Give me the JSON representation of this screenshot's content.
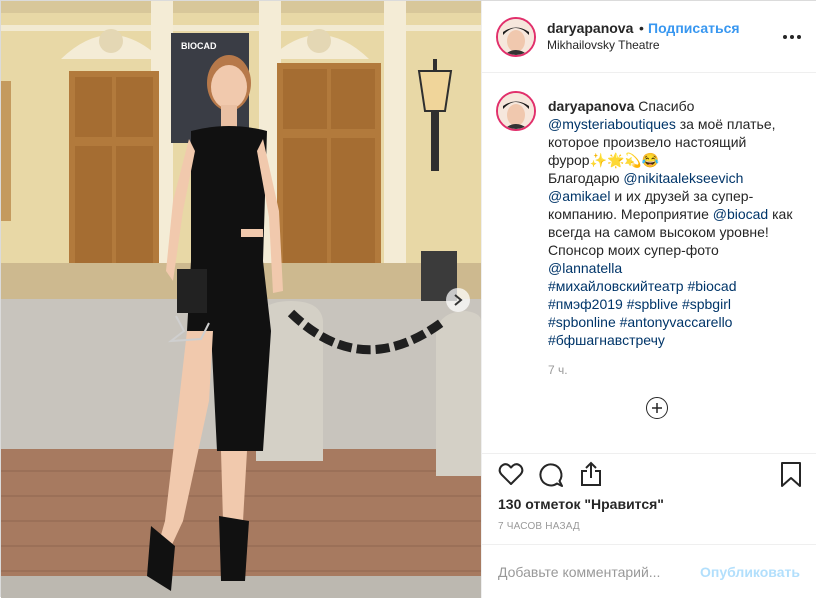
{
  "post": {
    "username": "daryapanova",
    "separator": "•",
    "follow_label": "Подписаться",
    "location": "Mikhailovsky Theatre",
    "photo_sign_text": "BIOCAD"
  },
  "caption": {
    "username": "daryapanova",
    "text_1": " Спасибо",
    "mention_1": "@mysteriaboutiques",
    "text_2": " за моё платье,",
    "text_3": "которое произвело настоящий",
    "text_4": "фурор✨🌟💫😂",
    "text_5": "Благодарю ",
    "mention_2": "@nikitaalekseevich",
    "mention_3": "@amikael",
    "text_6": " и их друзей за супер-",
    "text_7": "компанию. Мероприятие ",
    "mention_4": "@biocad",
    "text_8": " как",
    "text_9": "всегда на самом высоком уровне!",
    "text_10": "Спонсор моих супер-фото",
    "mention_5": "@lannatella",
    "hashtags_line_1": "#михайловскийтеатр #biocad",
    "hashtags_line_2": "#пмэф2019 #spblive #spbgirl",
    "hashtags_line_3": "#spbonline #antonyvaccarello",
    "hashtags_line_4": "#бфшагнавстречу",
    "time": "7 ч."
  },
  "icons": {
    "like": "heart-icon",
    "comment": "comment-icon",
    "share": "share-icon",
    "save": "bookmark-icon",
    "more": "more-options-icon",
    "load_more": "plus-circle-icon",
    "next": "chevron-right-icon"
  },
  "stats": {
    "likes": "130 отметок \"Нравится\"",
    "date": "7 ЧАСОВ НАЗАД"
  },
  "add_comment": {
    "placeholder": "Добавьте комментарий...",
    "publish_label": "Опубликовать"
  },
  "colors": {
    "link": "#003569",
    "follow": "#3897f0",
    "publish_disabled": "#b2dffc",
    "avatar_ring": "#e1306c"
  }
}
